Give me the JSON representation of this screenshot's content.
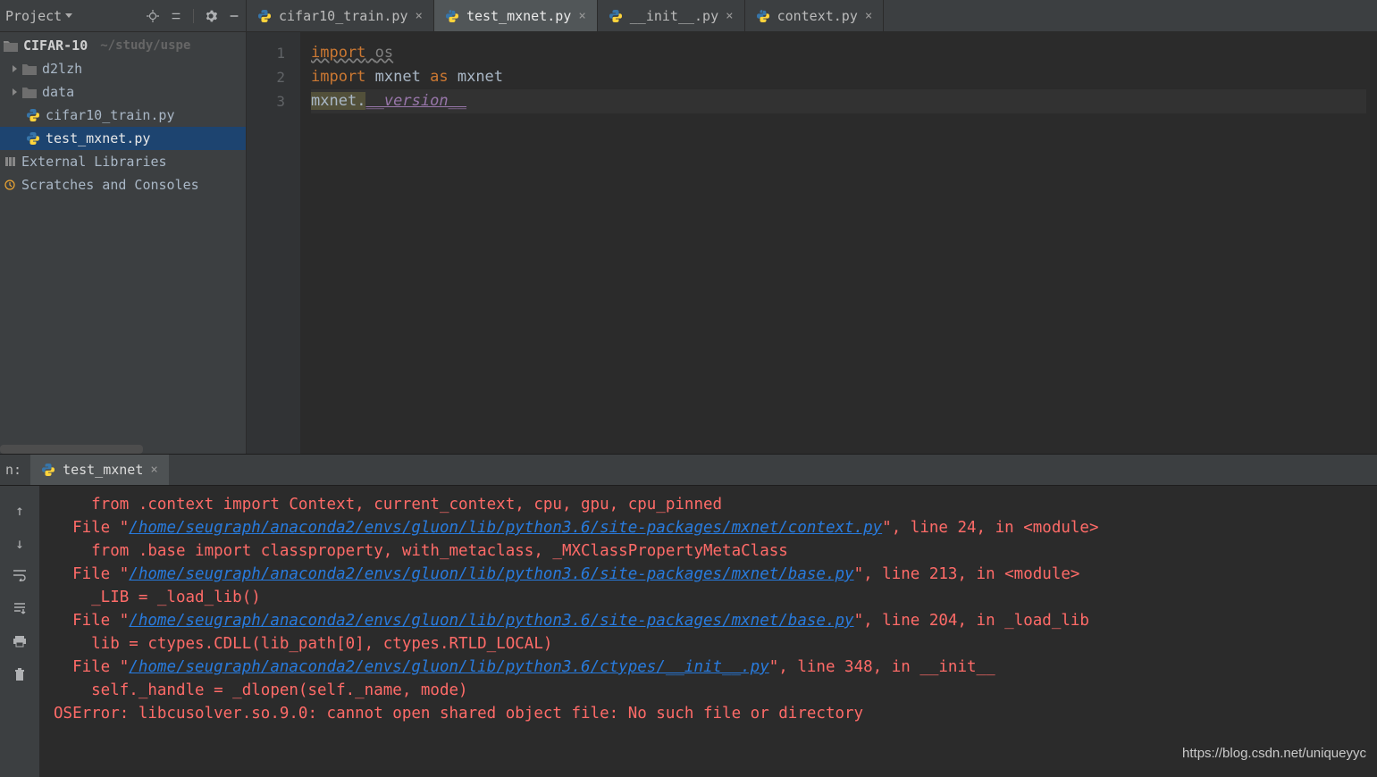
{
  "sidebar": {
    "title": "Project",
    "project_root": "CIFAR-10",
    "project_path": "~/study/uspe",
    "items": [
      {
        "label": "d2lzh",
        "type": "folder"
      },
      {
        "label": "data",
        "type": "folder"
      },
      {
        "label": "cifar10_train.py",
        "type": "python"
      },
      {
        "label": "test_mxnet.py",
        "type": "python",
        "selected": true
      }
    ],
    "extras": [
      "External Libraries",
      "Scratches and Consoles"
    ]
  },
  "tabs": [
    {
      "label": "cifar10_train.py"
    },
    {
      "label": "test_mxnet.py",
      "active": true
    },
    {
      "label": "__init__.py"
    },
    {
      "label": "context.py"
    }
  ],
  "editor": {
    "lines": [
      "1",
      "2",
      "3"
    ],
    "code": {
      "l1_kw": "import",
      "l1_mod": "os",
      "l2_kw": "import",
      "l2_mod": "mxnet",
      "l2_as": "as",
      "l2_alias": "mxnet",
      "l3_obj": "mxnet",
      "l3_dot": ".",
      "l3_attr": "__version__"
    }
  },
  "run": {
    "panel_label": "n:",
    "tab_label": "test_mxnet",
    "console": {
      "line1_indent": "    from .context import Context, current_context, cpu, gpu, cpu_pinned",
      "file_label": "  File \"",
      "path1": "/home/seugraph/anaconda2/envs/gluon/lib/python3.6/site-packages/mxnet/context.py",
      "loc1": "\", line 24, in <module>",
      "detail1": "    from .base import classproperty, with_metaclass, _MXClassPropertyMetaClass",
      "path2": "/home/seugraph/anaconda2/envs/gluon/lib/python3.6/site-packages/mxnet/base.py",
      "loc2": "\", line 213, in <module>",
      "detail2": "    _LIB = _load_lib()",
      "path3": "/home/seugraph/anaconda2/envs/gluon/lib/python3.6/site-packages/mxnet/base.py",
      "loc3": "\", line 204, in _load_lib",
      "detail3": "    lib = ctypes.CDLL(lib_path[0], ctypes.RTLD_LOCAL)",
      "path4": "/home/seugraph/anaconda2/envs/gluon/lib/python3.6/ctypes/__init__.py",
      "loc4": "\", line 348, in __init__",
      "detail4": "    self._handle = _dlopen(self._name, mode)",
      "error": "OSError: libcusolver.so.9.0: cannot open shared object file: No such file or directory"
    }
  },
  "watermark": "https://blog.csdn.net/uniqueyyc"
}
